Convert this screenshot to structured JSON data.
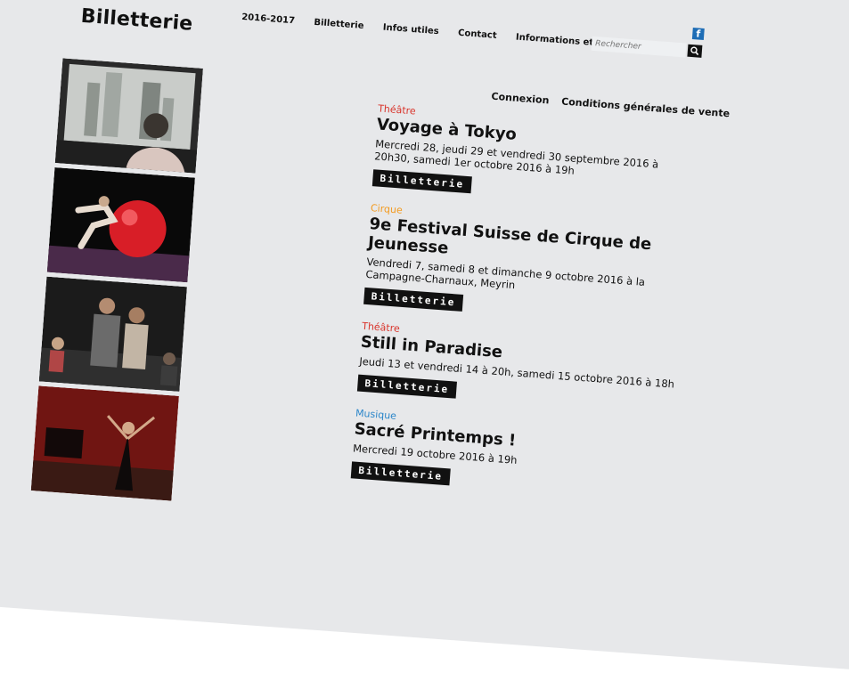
{
  "nav": {
    "items": [
      "2016-2017",
      "Billetterie",
      "Infos utiles",
      "Contact",
      "Informations et horaires"
    ]
  },
  "site": {
    "title": "Billetterie"
  },
  "search": {
    "placeholder": "Rechercher"
  },
  "account": {
    "login": "Connexion",
    "terms": "Conditions générales de vente"
  },
  "events": [
    {
      "category": "Théâtre",
      "category_color": "#d9342b",
      "title": "Voyage à Tokyo",
      "dates": "Mercredi 28, jeudi 29 et vendredi 30 septembre 2016 à 20h30, samedi 1er octobre 2016 à 19h",
      "button": "Billetterie"
    },
    {
      "category": "Cirque",
      "category_color": "#f39a1e",
      "title": "9e Festival Suisse de Cirque de Jeunesse",
      "dates": "Vendredi 7, samedi 8 et dimanche 9 octobre 2016 à la Campagne-Charnaux, Meyrin",
      "button": "Billetterie"
    },
    {
      "category": "Théâtre",
      "category_color": "#d9342b",
      "title": "Still in Paradise",
      "dates": "Jeudi 13 et vendredi 14 à 20h, samedi 15 octobre 2016 à 18h",
      "button": "Billetterie"
    },
    {
      "category": "Musique",
      "category_color": "#2b86c9",
      "title": "Sacré Printemps !",
      "dates": "Mercredi 19 octobre 2016 à 19h",
      "button": "Billetterie"
    }
  ],
  "photos": [
    "tokyo-window-photo",
    "circus-ball-photo",
    "stage-audience-photo",
    "singer-red-stage-photo"
  ],
  "icons": {
    "facebook": "facebook-icon",
    "search": "search-icon"
  },
  "colors": {
    "page_background": "#e7e8ea",
    "button_background": "#111111"
  }
}
